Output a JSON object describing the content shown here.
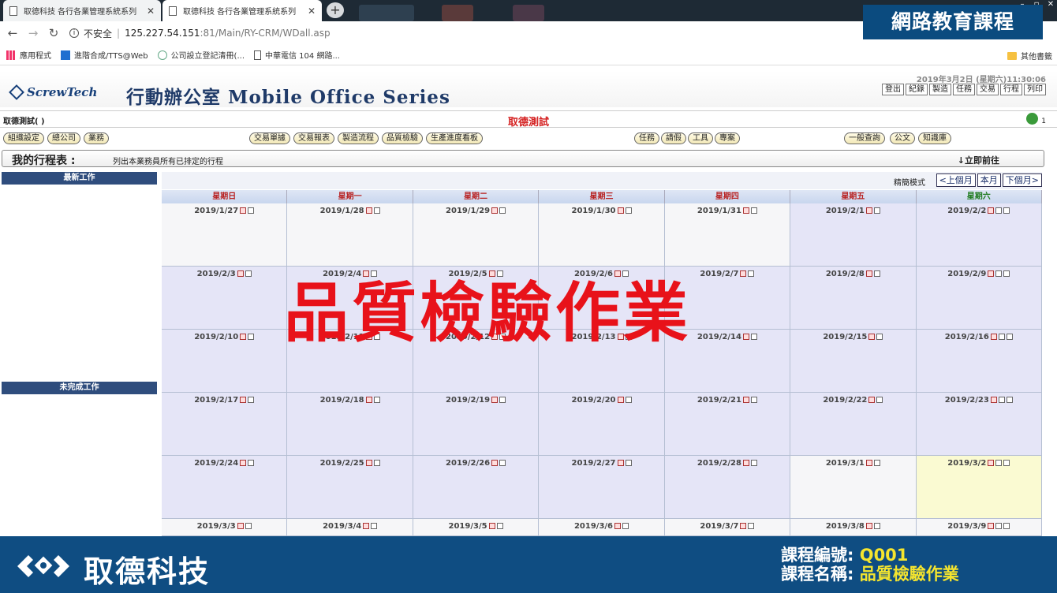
{
  "browser": {
    "tabs": [
      {
        "title": "取德科技 各行各業管理系統系列"
      },
      {
        "title": "取德科技 各行各業管理系統系列"
      }
    ],
    "address": {
      "security": "不安全",
      "host": "125.227.54.151",
      "path": ":81/Main/RY-CRM/WDall.asp"
    },
    "bookmarks": [
      {
        "label": "應用程式"
      },
      {
        "label": "進階合成/TTS@Web"
      },
      {
        "label": "公司設立登記清冊(..."
      },
      {
        "label": "中華電信 104 網路..."
      }
    ],
    "other_bookmarks": "其他書籤"
  },
  "overlay": {
    "edu_banner": "網路教育課程",
    "watermark": "品質檢驗作業",
    "brand_name": "取德科技",
    "course_no_label": "課程編號:",
    "course_no": "Q001",
    "course_name_label": "課程名稱:",
    "course_name": "品質檢驗作業"
  },
  "app": {
    "logo": "ScrewTech",
    "series_title": "行動辦公室 Mobile Office Series",
    "datetime": "2019年3月2日 (星期六)11:30:06",
    "top_menu": [
      "登出",
      "紀錄",
      "製造",
      "任務",
      "交易",
      "行程",
      "列印"
    ],
    "user_label": "取德測試( )",
    "company": "取德測試",
    "notify_count": "1",
    "nav_left": [
      "組織設定",
      "總公司",
      "業務"
    ],
    "nav_mid": [
      "交易單據",
      "交易報表",
      "製造流程",
      "品質檢驗",
      "生產進度看板"
    ],
    "nav_mid2": [
      "任務",
      "請假",
      "工具",
      "專案"
    ],
    "nav_right": [
      "一般查詢",
      "公文",
      "知識庫"
    ],
    "schedule_title": "我的行程表 :",
    "schedule_desc": "列出本業務員所有已排定的行程",
    "goto": "↓立即前往",
    "side_latest": "最新工作",
    "side_unfinished": "未完成工作",
    "cal_style": "精簡模式",
    "cal_nav": [
      "<上個月",
      "本月",
      "下個月>"
    ],
    "weekdays": [
      "星期日",
      "星期一",
      "星期二",
      "星期三",
      "星期四",
      "星期五",
      "星期六"
    ],
    "weeks": [
      [
        "2019/1/27",
        "2019/1/28",
        "2019/1/29",
        "2019/1/30",
        "2019/1/31",
        "2019/2/1",
        "2019/2/2"
      ],
      [
        "2019/2/3",
        "2019/2/4",
        "2019/2/5",
        "2019/2/6",
        "2019/2/7",
        "2019/2/8",
        "2019/2/9"
      ],
      [
        "2019/2/10",
        "2019/2/11",
        "2019/2/12",
        "2019/2/13",
        "2019/2/14",
        "2019/2/15",
        "2019/2/16"
      ],
      [
        "2019/2/17",
        "2019/2/18",
        "2019/2/19",
        "2019/2/20",
        "2019/2/21",
        "2019/2/22",
        "2019/2/23"
      ],
      [
        "2019/2/24",
        "2019/2/25",
        "2019/2/26",
        "2019/2/27",
        "2019/2/28",
        "2019/3/1",
        "2019/3/2"
      ],
      [
        "2019/3/3",
        "2019/3/4",
        "2019/3/5",
        "2019/3/6",
        "2019/3/7",
        "2019/3/8",
        "2019/3/9"
      ]
    ]
  }
}
